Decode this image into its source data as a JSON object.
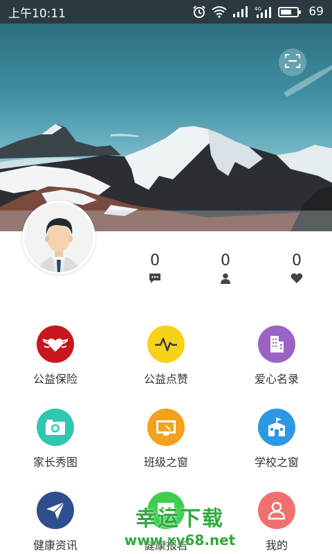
{
  "status_bar": {
    "time": "上午10:11",
    "battery_level": "69",
    "battery_fraction": 0.69,
    "icons": [
      "alarm-icon",
      "wifi-icon",
      "signal-icon",
      "signal-4g-icon",
      "battery-icon"
    ]
  },
  "header": {
    "scan_icon": "scan-icon"
  },
  "profile": {
    "avatar_icon": "user-avatar-icon"
  },
  "stats": [
    {
      "value": "0",
      "icon": "message-icon"
    },
    {
      "value": "0",
      "icon": "person-icon"
    },
    {
      "value": "0",
      "icon": "heart-icon"
    }
  ],
  "menu": [
    {
      "label": "公益保险",
      "icon": "heart-wings-icon",
      "color": "#c7161e"
    },
    {
      "label": "公益点赞",
      "icon": "pulse-icon",
      "color": "#f7d21b"
    },
    {
      "label": "爱心名录",
      "icon": "building-icon",
      "color": "#9b63c4"
    },
    {
      "label": "家长秀图",
      "icon": "camera-icon",
      "color": "#2fc7b0"
    },
    {
      "label": "班级之窗",
      "icon": "chalkboard-icon",
      "color": "#f4a11b"
    },
    {
      "label": "学校之窗",
      "icon": "school-icon",
      "color": "#2d98e3"
    },
    {
      "label": "健康资讯",
      "icon": "paper-plane-icon",
      "color": "#2f4e8e"
    },
    {
      "label": "健康报告",
      "icon": "chat-icon",
      "color": "#3ccf4e"
    },
    {
      "label": "我的",
      "icon": "user-icon",
      "color": "#f07070"
    }
  ],
  "watermark": {
    "title": "幸运下载",
    "url": "www.xy68.net"
  }
}
